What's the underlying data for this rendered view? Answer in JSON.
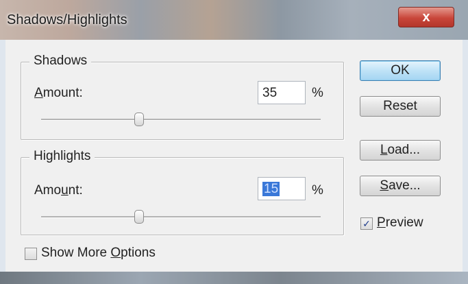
{
  "window": {
    "title": "Shadows/Highlights",
    "close_label": "x"
  },
  "shadows": {
    "legend": "Shadows",
    "amount_label_accel": "A",
    "amount_label_rest": "mount:",
    "amount_value": "35",
    "unit": "%",
    "slider_level": 0.35
  },
  "highlights": {
    "legend": "Highlights",
    "amount_label_pre": "Amo",
    "amount_label_accel": "u",
    "amount_label_post": "nt:",
    "amount_value": "15",
    "unit": "%",
    "slider_level": 0.35
  },
  "buttons": {
    "ok": "OK",
    "reset": "Reset",
    "load_accel": "L",
    "load_rest": "oad...",
    "save_accel": "S",
    "save_rest": "ave..."
  },
  "preview": {
    "accel": "P",
    "rest": "review",
    "checked": true,
    "check_glyph": "✓"
  },
  "more_options": {
    "pre": "Show More ",
    "accel": "O",
    "post": "ptions",
    "checked": false
  }
}
